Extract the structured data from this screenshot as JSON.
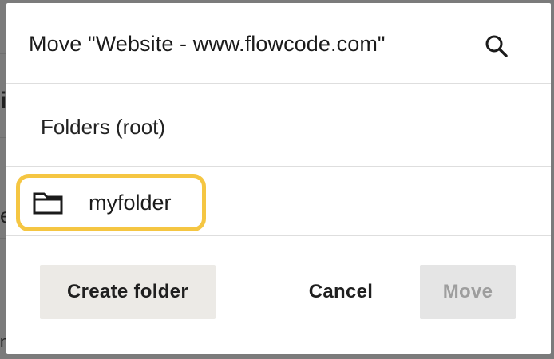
{
  "background": {
    "glyph_top": "i",
    "glyph_mid": "e",
    "glyph_bottom": "n"
  },
  "dialog": {
    "title": "Move \"Website - www.flowcode.com\"",
    "search_icon": "search-icon",
    "root_label": "Folders (root)",
    "folders": [
      {
        "name": "myfolder",
        "icon": "folder-icon",
        "highlighted": true
      }
    ],
    "buttons": {
      "create_folder": "Create folder",
      "cancel": "Cancel",
      "move": "Move"
    },
    "move_disabled": true
  },
  "colors": {
    "highlight": "#f5c642",
    "create_button_bg": "#eceae6",
    "move_button_bg_disabled": "#e5e5e5",
    "move_button_text_disabled": "#9e9e9e",
    "overlay": "#7b7b7b"
  }
}
